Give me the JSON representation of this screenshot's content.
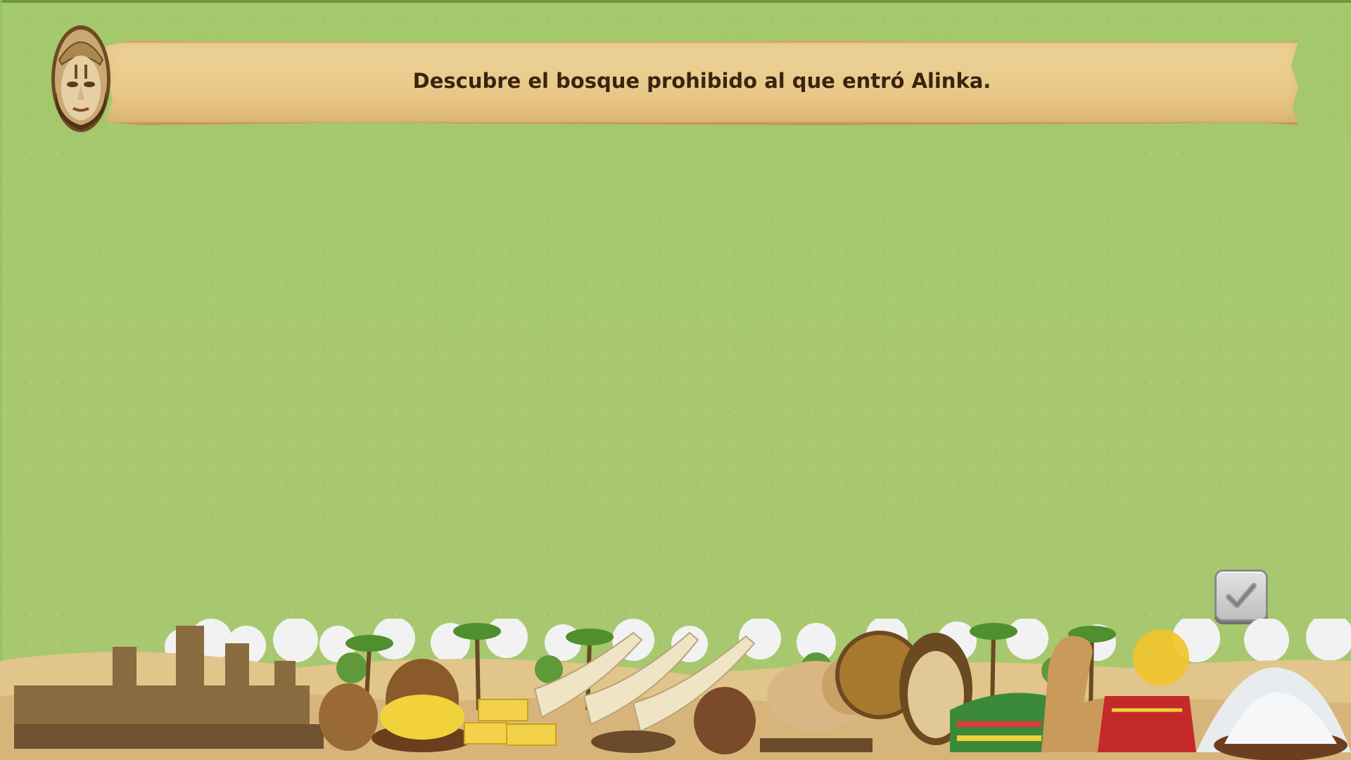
{
  "instruction": {
    "text": "Descubre el bosque prohibido al que entró Alinka."
  },
  "icons": {
    "avatar": "tribal-mask-icon",
    "confirm": "checkmark-icon"
  },
  "colors": {
    "background": "#a7c86e",
    "scroll": "#ecce92",
    "text": "#3a2410",
    "confirm_button": "#cfcfcf"
  }
}
